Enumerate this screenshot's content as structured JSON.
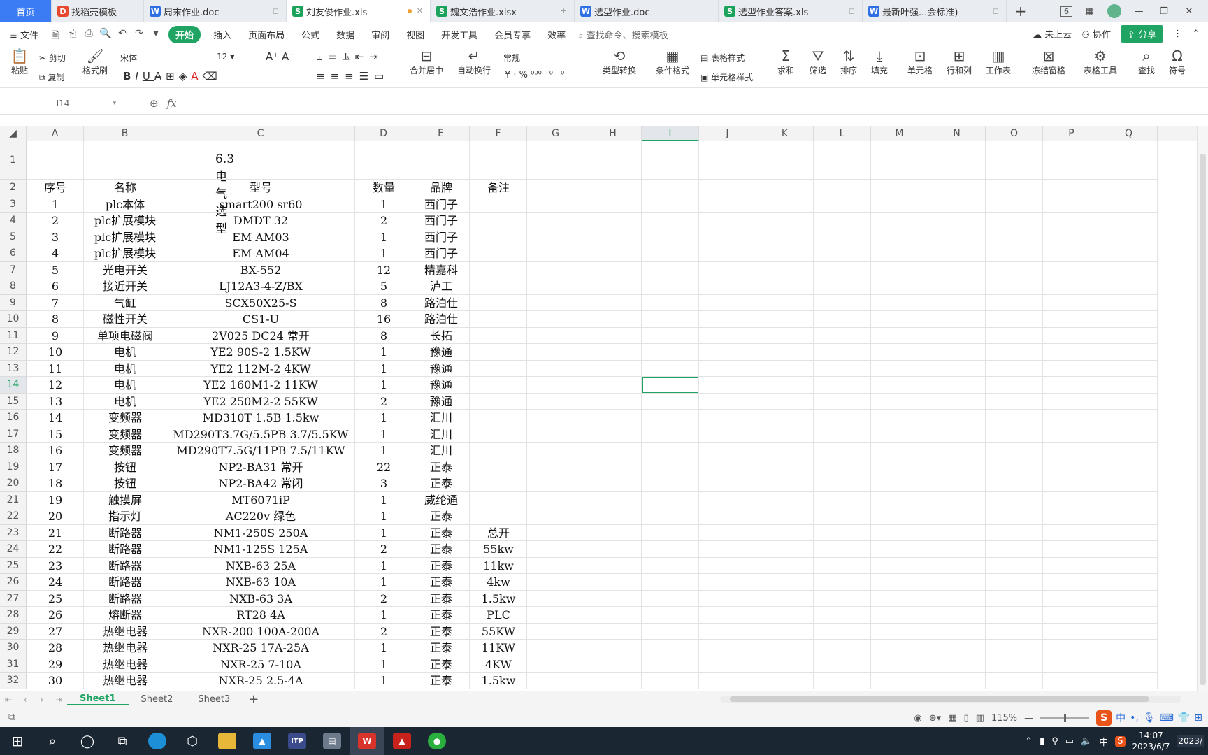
{
  "tabs": [
    {
      "label": "首页",
      "icon": "",
      "type": "home"
    },
    {
      "label": "找稻壳模板",
      "icon": "D",
      "type": "p"
    },
    {
      "label": "周末作业.doc",
      "icon": "W",
      "type": "w"
    },
    {
      "label": "刘友俊作业.xls",
      "icon": "S",
      "type": "s",
      "active": true
    },
    {
      "label": "魏文浩作业.xlsx",
      "icon": "S",
      "type": "s"
    },
    {
      "label": "选型作业.doc",
      "icon": "W",
      "type": "w"
    },
    {
      "label": "选型作业答案.xls",
      "icon": "S",
      "type": "s"
    },
    {
      "label": "最新叶强...会标准)",
      "icon": "W",
      "type": "w"
    }
  ],
  "window": {
    "badge": "6",
    "minimize": "—",
    "restore": "❐",
    "close": "✕"
  },
  "menu": {
    "file": "文件",
    "items": [
      "开始",
      "插入",
      "页面布局",
      "公式",
      "数据",
      "审阅",
      "视图",
      "开发工具",
      "会员专享",
      "效率"
    ],
    "active": "开始",
    "search": "查找命令、搜索模板",
    "cloud": "未上云",
    "collab": "协作",
    "share": "分享"
  },
  "ribbon": {
    "paste": "粘贴",
    "cut": "剪切",
    "copy": "复制",
    "format_painter": "格式刷",
    "font_name": "宋体",
    "font_size": "12",
    "merge_center": "合并居中",
    "wrap": "自动换行",
    "number_format": "常规",
    "type_convert": "类型转换",
    "cond_format": "条件格式",
    "table_style": "表格样式",
    "cell_style": "单元格样式",
    "sum": "求和",
    "filter": "筛选",
    "sort": "排序",
    "fill": "填充",
    "cells": "单元格",
    "row_col": "行和列",
    "worksheet": "工作表",
    "freeze": "冻结窗格",
    "table_tools": "表格工具",
    "find": "查找",
    "symbol": "符号"
  },
  "formula_bar": {
    "name_box": "I14",
    "fx": "fx",
    "content": ""
  },
  "columns": [
    "A",
    "B",
    "C",
    "D",
    "E",
    "F",
    "G",
    "H",
    "I",
    "J",
    "K",
    "L",
    "M",
    "N",
    "O",
    "P",
    "Q"
  ],
  "selected_column": "I",
  "selected_row": "14",
  "sheet": {
    "title": "6.3电气选型",
    "header": [
      "序号",
      "名称",
      "型号",
      "数量",
      "品牌",
      "备注"
    ],
    "rows": [
      [
        "1",
        "plc本体",
        "smart200   sr60",
        "1",
        "西门子",
        ""
      ],
      [
        "2",
        "plc扩展模块",
        "DMDT  32",
        "2",
        "西门子",
        ""
      ],
      [
        "3",
        "plc扩展模块",
        "EM AM03",
        "1",
        "西门子",
        ""
      ],
      [
        "4",
        "plc扩展模块",
        "EM AM04",
        "1",
        "西门子",
        ""
      ],
      [
        "5",
        "光电开关",
        "BX-552",
        "12",
        "精嘉科",
        ""
      ],
      [
        "6",
        "接近开关",
        "LJ12A3-4-Z/BX",
        "5",
        "泸工",
        ""
      ],
      [
        "7",
        "气缸",
        "SCX50X25-S",
        "8",
        "路泊仕",
        ""
      ],
      [
        "8",
        "磁性开关",
        "CS1-U",
        "16",
        "路泊仕",
        ""
      ],
      [
        "9",
        "单项电磁阀",
        "2V025 DC24  常开",
        "8",
        "长拓",
        ""
      ],
      [
        "10",
        "电机",
        "YE2 90S-2   1.5KW",
        "1",
        "豫通",
        ""
      ],
      [
        "11",
        "电机",
        "YE2  112M-2  4KW",
        "1",
        "豫通",
        ""
      ],
      [
        "12",
        "电机",
        "YE2  160M1-2  11KW",
        "1",
        "豫通",
        ""
      ],
      [
        "13",
        "电机",
        "YE2 250M2-2  55KW",
        "2",
        "豫通",
        ""
      ],
      [
        "14",
        "变频器",
        "MD310T   1.5B      1.5kw",
        "1",
        "汇川",
        ""
      ],
      [
        "15",
        "变频器",
        "MD290T3.7G/5.5PB 3.7/5.5KW",
        "1",
        "汇川",
        ""
      ],
      [
        "16",
        "变频器",
        "MD290T7.5G/11PB 7.5/11KW",
        "1",
        "汇川",
        ""
      ],
      [
        "17",
        "按钮",
        "NP2-BA31   常开",
        "22",
        "正泰",
        ""
      ],
      [
        "18",
        "按钮",
        "NP2-BA42   常闭",
        "3",
        "正泰",
        ""
      ],
      [
        "19",
        "触摸屏",
        "MT6071iP",
        "1",
        "威纶通",
        ""
      ],
      [
        "20",
        "指示灯",
        "AC220v  绿色",
        "1",
        "正泰",
        ""
      ],
      [
        "21",
        "断路器",
        "NM1-250S    250A",
        "1",
        "正泰",
        "总开"
      ],
      [
        "22",
        "断路器",
        "NM1-125S   125A",
        "2",
        "正泰",
        "55kw"
      ],
      [
        "23",
        "断路器",
        "NXB-63    25A",
        "1",
        "正泰",
        "11kw"
      ],
      [
        "24",
        "断路器",
        "NXB-63    10A",
        "1",
        "正泰",
        "4kw"
      ],
      [
        "25",
        "断路器",
        "NXB-63     3A",
        "2",
        "正泰",
        "1.5kw"
      ],
      [
        "26",
        "熔断器",
        "RT28        4A",
        "1",
        "正泰",
        "PLC"
      ],
      [
        "27",
        "热继电器",
        "NXR-200   100A-200A",
        "2",
        "正泰",
        "55KW"
      ],
      [
        "28",
        "热继电器",
        "NXR-25    17A-25A",
        "1",
        "正泰",
        "11KW"
      ],
      [
        "29",
        "热继电器",
        "NXR-25    7-10A",
        "1",
        "正泰",
        "4KW"
      ],
      [
        "30",
        "热继电器",
        "NXR-25    2.5-4A",
        "1",
        "正泰",
        "1.5kw"
      ]
    ]
  },
  "sheet_tabs": [
    "Sheet1",
    "Sheet2",
    "Sheet3"
  ],
  "active_sheet": "Sheet1",
  "status": {
    "zoom": "115%",
    "ime": "中",
    "ime_brand": "S"
  },
  "taskbar": {
    "time": "14:07",
    "date": "2023/6/7",
    "lang": "中",
    "corner": "2023/"
  },
  "colors": {
    "accent": "#1fa463",
    "home_tab": "#3b7cf4",
    "taskbar": "#1b2633"
  }
}
